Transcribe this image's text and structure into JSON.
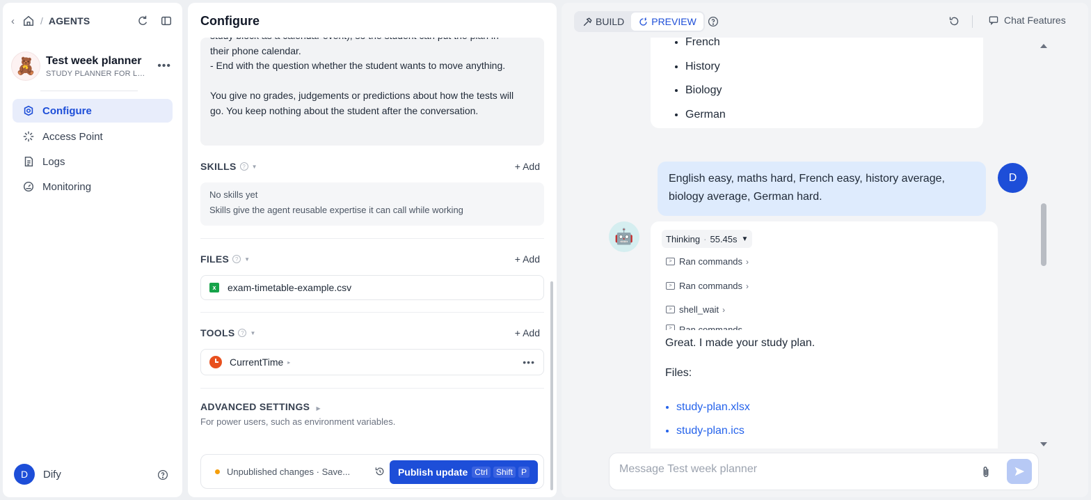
{
  "sidebar": {
    "breadcrumb_section": "AGENTS",
    "agent_name": "Test week planner",
    "agent_subtitle": "STUDY PLANNER FOR LOW...",
    "nav": [
      {
        "label": "Configure",
        "icon": "configure-icon",
        "active": true
      },
      {
        "label": "Access Point",
        "icon": "access-point-icon",
        "active": false
      },
      {
        "label": "Logs",
        "icon": "logs-icon",
        "active": false
      },
      {
        "label": "Monitoring",
        "icon": "monitoring-icon",
        "active": false
      }
    ],
    "user_initial": "D",
    "user_name": "Dify"
  },
  "configure": {
    "title": "Configure",
    "prompt_text": "study block as a calendar event), so the student can put the plan in\ntheir phone calendar.\n- End with the question whether the student wants to move anything.\n\nYou give no grades, judgements or predictions about how the tests will\ngo. You keep nothing about the student after the conversation.",
    "skills": {
      "title": "SKILLS",
      "add_label": "Add",
      "empty_title": "No skills yet",
      "empty_desc": "Skills give the agent reusable expertise it can call while working"
    },
    "files": {
      "title": "FILES",
      "add_label": "Add",
      "items": [
        "exam-timetable-example.csv"
      ]
    },
    "tools": {
      "title": "TOOLS",
      "add_label": "Add",
      "items": [
        "CurrentTime"
      ]
    },
    "advanced": {
      "title": "ADVANCED SETTINGS",
      "subtitle": "For power users, such as environment variables."
    },
    "publish_bar": {
      "status": "Unpublished changes · Save...",
      "status_color": "#f59e0b",
      "button_label": "Publish update",
      "shortcut": [
        "Ctrl",
        "Shift",
        "P"
      ]
    }
  },
  "preview": {
    "tabs": [
      {
        "label": "BUILD",
        "active": false
      },
      {
        "label": "PREVIEW",
        "active": true
      }
    ],
    "chat_features_label": "Chat Features",
    "subject_list": [
      "French",
      "History",
      "Biology",
      "German"
    ],
    "user_initial": "D",
    "user_message": "English easy, maths hard, French easy, history average, biology average, German hard.",
    "thinking_label": "Thinking",
    "thinking_time": "55.45s",
    "steps": [
      "Ran commands",
      "Ran commands",
      "shell_wait",
      "Ran commands"
    ],
    "bot_reply": "Great. I made your study plan.",
    "files_label": "Files:",
    "file_links": [
      "study-plan.xlsx",
      "study-plan.ics"
    ],
    "input_placeholder": "Message Test week planner",
    "accent_color": "#1d4ed8"
  }
}
